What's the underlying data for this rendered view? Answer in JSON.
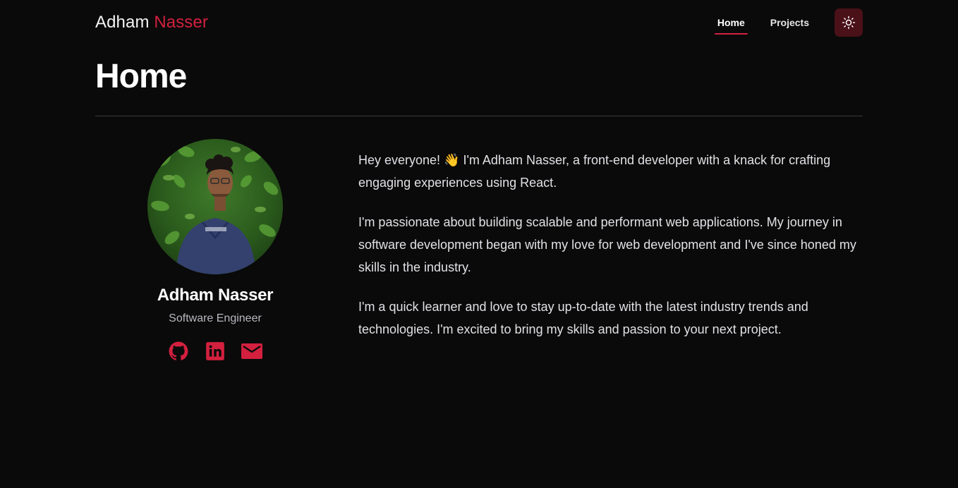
{
  "brand": {
    "first": "Adham",
    "last": "Nasser"
  },
  "nav": {
    "items": [
      {
        "label": "Home",
        "active": true
      },
      {
        "label": "Projects",
        "active": false
      }
    ],
    "theme_toggle_icon": "sun-icon"
  },
  "page": {
    "title": "Home"
  },
  "profile": {
    "name": "Adham Nasser",
    "role": "Software Engineer",
    "avatar_icon": "profile-photo",
    "socials": [
      {
        "icon": "github-icon"
      },
      {
        "icon": "linkedin-icon"
      },
      {
        "icon": "mail-icon"
      }
    ]
  },
  "bio": {
    "paragraphs": [
      "Hey everyone! 👋 I'm Adham Nasser, a front-end developer with a knack for crafting engaging experiences using React.",
      "I'm passionate about building scalable and performant web applications. My journey in software development began with my love for web development and I've since honed my skills in the industry.",
      "I'm a quick learner and love to stay up-to-date with the latest industry trends and technologies. I'm excited to bring my skills and passion to your next project."
    ]
  },
  "colors": {
    "background": "#0a0a0a",
    "accent": "#d3203f",
    "theme_button_bg": "#4a1119"
  }
}
